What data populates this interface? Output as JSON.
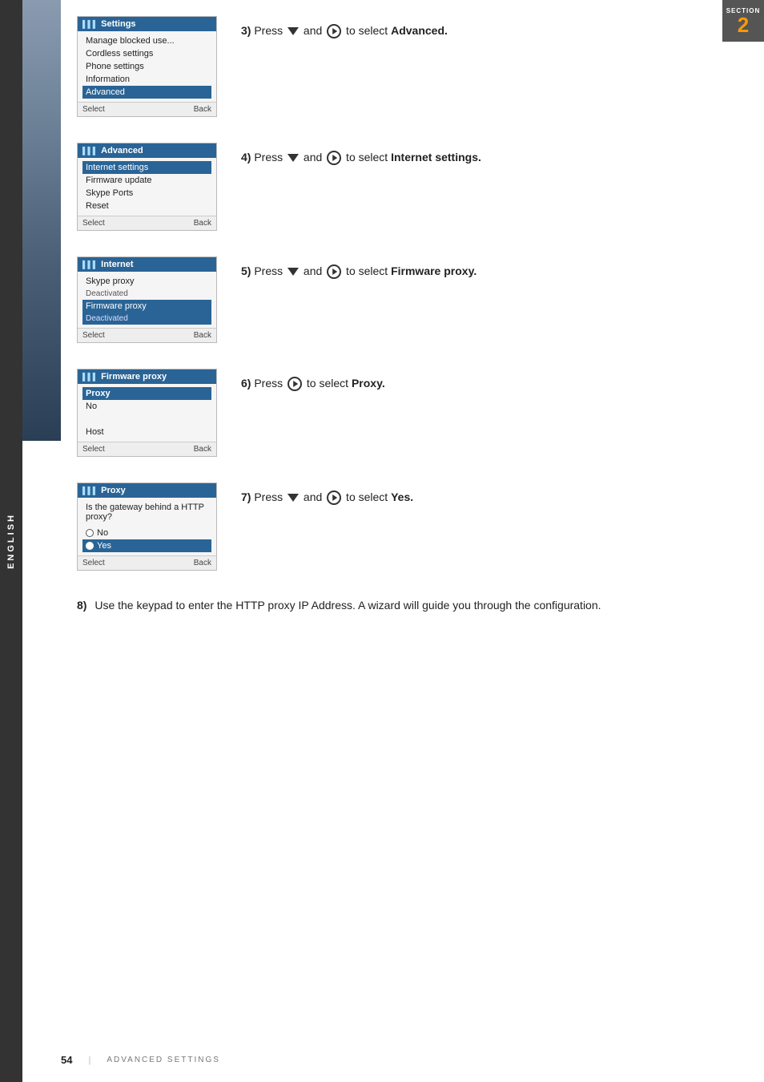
{
  "section": {
    "label": "SECTION",
    "number": "2"
  },
  "sidebar": {
    "language": "ENGLISH"
  },
  "steps": [
    {
      "number": "3)",
      "pre": "Press",
      "post": "to select",
      "action_word": "Advanced.",
      "screen": {
        "header_icon": "signal",
        "header_title": "Settings",
        "items": [
          {
            "text": "Manage blocked use...",
            "highlighted": false
          },
          {
            "text": "Cordless settings",
            "highlighted": false
          },
          {
            "text": "Phone settings",
            "highlighted": false
          },
          {
            "text": "Information",
            "highlighted": false
          },
          {
            "text": "Advanced",
            "highlighted": true
          }
        ],
        "footer_left": "Select",
        "footer_right": "Back"
      }
    },
    {
      "number": "4)",
      "pre": "Press",
      "post": "to select",
      "action_word": "Internet settings.",
      "screen": {
        "header_icon": "signal",
        "header_title": "Advanced",
        "items": [
          {
            "text": "Internet settings",
            "highlighted": true
          },
          {
            "text": "Firmware update",
            "highlighted": false
          },
          {
            "text": "Skype Ports",
            "highlighted": false
          },
          {
            "text": "Reset",
            "highlighted": false
          }
        ],
        "footer_left": "Select",
        "footer_right": "Back"
      }
    },
    {
      "number": "5)",
      "pre": "Press",
      "post": "to select",
      "action_word": "Firmware proxy.",
      "screen": {
        "header_icon": "signal",
        "header_title": "Internet",
        "items": [
          {
            "text": "Skype proxy",
            "highlighted": false,
            "sub": "Deactivated"
          },
          {
            "text": "Firmware proxy",
            "highlighted": true,
            "sub": "Deactivated"
          }
        ],
        "footer_left": "Select",
        "footer_right": "Back"
      }
    },
    {
      "number": "6)",
      "pre": "Press",
      "post": "to select",
      "action_word": "Proxy.",
      "no_down_arrow": true,
      "screen": {
        "header_icon": "signal",
        "header_title": "Firmware proxy",
        "items": [
          {
            "text": "Proxy",
            "highlighted": true,
            "bold": true
          },
          {
            "text": "No",
            "highlighted": false
          },
          {
            "text": "",
            "highlighted": false,
            "is_host": true
          },
          {
            "text": "Host",
            "highlighted": false
          }
        ],
        "footer_left": "Select",
        "footer_right": "Back"
      }
    },
    {
      "number": "7)",
      "pre": "Press",
      "post": "to select",
      "action_word": "Yes.",
      "screen": {
        "header_icon": "signal",
        "header_title": "Proxy",
        "intro_text": "Is the gateway behind a HTTP proxy?",
        "radio_items": [
          {
            "label": "No",
            "highlighted": false
          },
          {
            "label": "Yes",
            "highlighted": true
          }
        ],
        "footer_left": "Select",
        "footer_right": "Back"
      }
    }
  ],
  "step8": {
    "number": "8)",
    "text": "Use the keypad to enter the HTTP proxy IP Address.  A wizard will guide you through the configuration."
  },
  "footer": {
    "page_number": "54",
    "section_text": "ADVANCED SETTINGS"
  }
}
